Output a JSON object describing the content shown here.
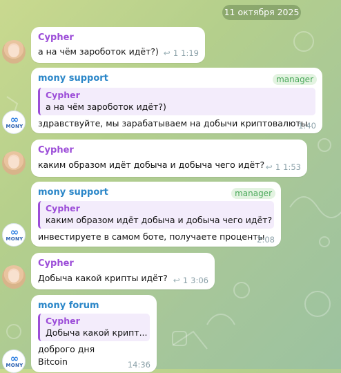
{
  "date_divider": "11 октября 2025",
  "messages": [
    {
      "sender": "Cypher",
      "text": "а на чём зароботок идёт?)",
      "reply_count": "1",
      "time": "1:19"
    },
    {
      "sender": "mony support",
      "badge": "manager",
      "quote_sender": "Cypher",
      "quote_text": "а на чём зароботок идёт?)",
      "text": "здравствуйте, мы зарабатываем на добычи криптовалюты",
      "time": "1:40"
    },
    {
      "sender": "Cypher",
      "text": "каким образом идёт добыча и добыча чего идёт?",
      "reply_count": "1",
      "time": "1:53"
    },
    {
      "sender": "mony support",
      "badge": "manager",
      "quote_sender": "Cypher",
      "quote_text": "каким образом идёт добыча и добыча чего идёт?",
      "text": "инвестируете в самом боте, получаете проценты",
      "time": "2:08"
    },
    {
      "sender": "Cypher",
      "text": "Добыча какой крипты идёт?",
      "reply_count": "1",
      "time": "3:06"
    },
    {
      "sender": "mony forum",
      "quote_sender": "Cypher",
      "quote_text": "Добыча какой крипт...",
      "text_line1": "доброго дня",
      "text_line2": "Bitcoin",
      "time": "14:36"
    }
  ],
  "avatars": {
    "mony_logo_text": "MONY"
  },
  "icons": {
    "reply": "reply-arrow-icon"
  },
  "colors": {
    "cypher_name": "#9c4dd8",
    "support_name": "#2a86c8",
    "badge": "#4aa85a"
  }
}
